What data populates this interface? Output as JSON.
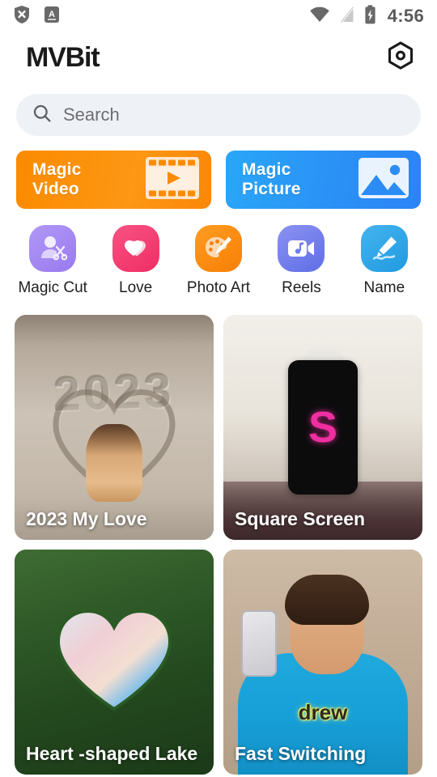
{
  "statusbar": {
    "time": "4:56",
    "left_icons": [
      "shield-x-icon",
      "a-badge-icon"
    ],
    "right_icons": [
      "wifi-icon",
      "no-sim-icon",
      "battery-charging-icon"
    ]
  },
  "header": {
    "logo": "MVBit",
    "settings_icon": "settings-hex-icon"
  },
  "search": {
    "placeholder": "Search",
    "value": "",
    "icon": "search-icon"
  },
  "banners": [
    {
      "title": "Magic\nVideo",
      "color": "#fb8b00",
      "icon": "film-play-icon"
    },
    {
      "title": "Magic\nPicture",
      "color": "#2b8cf5",
      "icon": "photo-mountain-icon"
    }
  ],
  "categories": [
    {
      "label": "Magic Cut",
      "color": "#a387f0",
      "icon": "person-scissors-icon"
    },
    {
      "label": "Love",
      "color": "#f4396f",
      "icon": "hearts-icon"
    },
    {
      "label": "Photo Art",
      "color": "#fb8b0e",
      "icon": "palette-brush-icon"
    },
    {
      "label": "Reels",
      "color": "#6d7ceb",
      "icon": "video-music-icon"
    },
    {
      "label": "Name",
      "color": "#31a6e8",
      "icon": "pen-signature-icon"
    }
  ],
  "grid": [
    {
      "label": "2023 My Love",
      "art": "sand-2023",
      "sand_text": "2023"
    },
    {
      "label": "Square Screen",
      "art": "square-screen",
      "led_char": "S"
    },
    {
      "label": "Heart -shaped Lake",
      "art": "heart-lake"
    },
    {
      "label": "Fast Switching",
      "art": "fast-switching",
      "hoodie_text": "drew"
    }
  ]
}
